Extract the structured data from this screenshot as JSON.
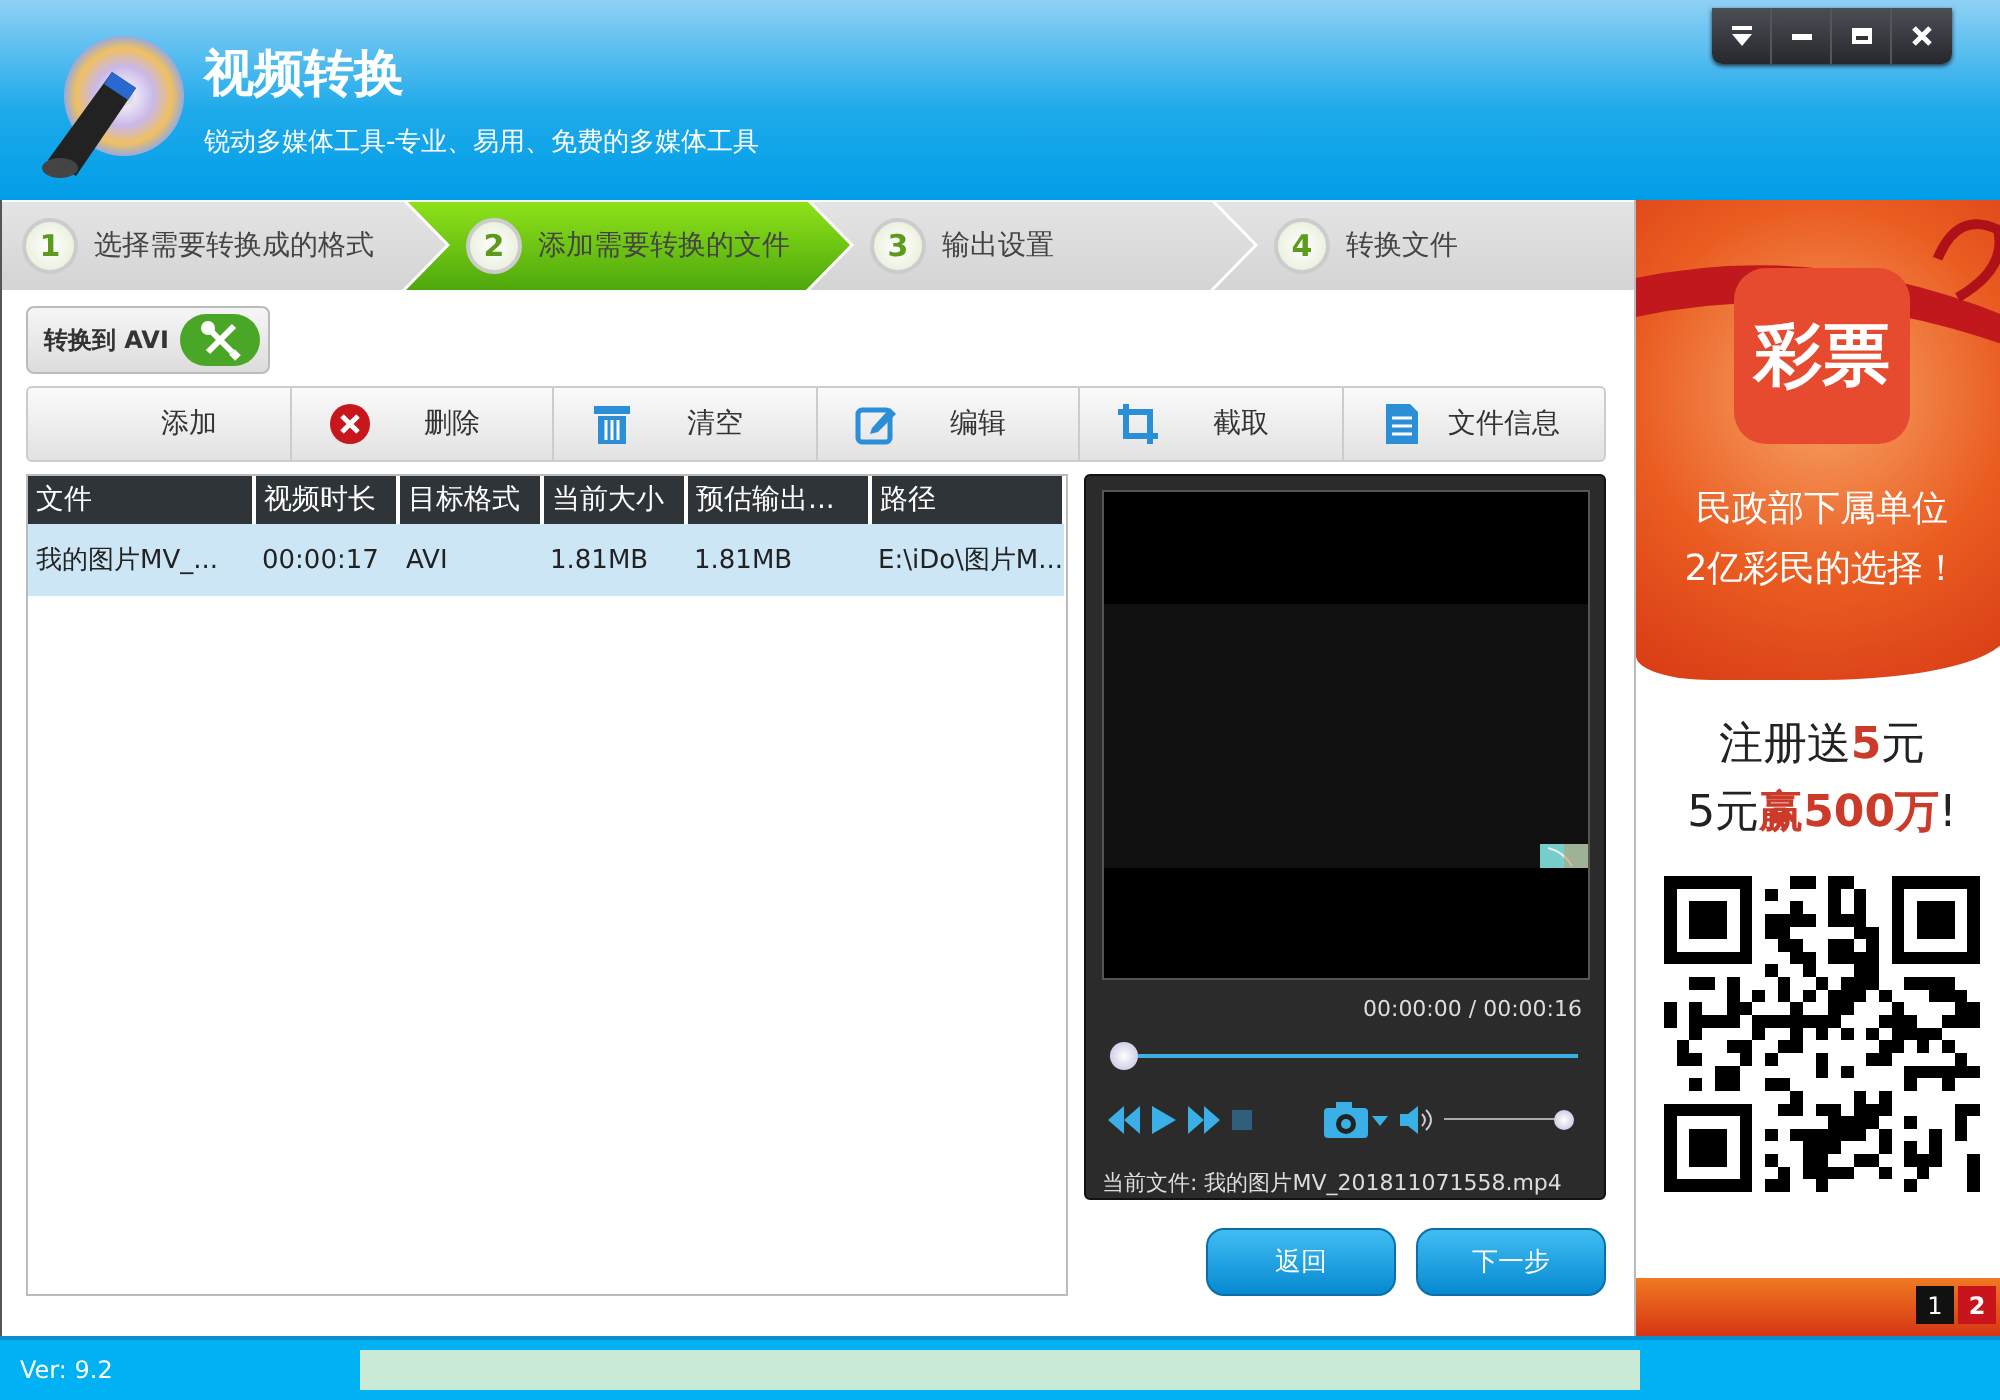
{
  "window": {
    "title": "视频转换",
    "subtitle": "锐动多媒体工具-专业、易用、免费的多媒体工具"
  },
  "steps": [
    {
      "number": "1",
      "label": "选择需要转换成的格式",
      "selected": false
    },
    {
      "number": "2",
      "label": "添加需要转换的文件",
      "selected": true
    },
    {
      "number": "3",
      "label": "输出设置",
      "selected": false
    },
    {
      "number": "4",
      "label": "转换文件",
      "selected": false
    }
  ],
  "format_button": {
    "label": "转换到 AVI"
  },
  "toolbar": [
    "添加",
    "删除",
    "清空",
    "编辑",
    "截取",
    "文件信息"
  ],
  "table": {
    "columns": [
      "文件",
      "视频时长",
      "目标格式",
      "当前大小",
      "预估输出...",
      "路径"
    ],
    "rows": [
      {
        "selected": true,
        "cells": [
          "我的图片MV_...",
          "00:00:17",
          "AVI",
          "1.81MB",
          "1.81MB",
          "E:\\iDo\\图片M..."
        ]
      }
    ]
  },
  "player": {
    "time": "00:00:00 / 00:00:16",
    "seek": {
      "level": 0
    },
    "volume": {
      "level": 1
    },
    "current_file": "当前文件: 我的图片MV_201811071558.mp4"
  },
  "buttons": [
    "返回",
    "下一步"
  ],
  "ad": {
    "logo": "彩票",
    "lines": [
      "民政部下属单位",
      "2亿彩民的选择！"
    ],
    "offer": [
      [
        {
          "text": "注册送",
          "highlight": false
        },
        {
          "text": "5",
          "highlight": true
        },
        {
          "text": "元",
          "highlight": false
        }
      ],
      [
        {
          "text": "5元",
          "highlight": false
        },
        {
          "text": "赢500万",
          "highlight": true
        },
        {
          "text": "!",
          "highlight": false
        }
      ]
    ],
    "pages": [
      {
        "label": "1",
        "selected": false
      },
      {
        "label": "2",
        "selected": true
      }
    ]
  },
  "status_bar": {
    "version": "Ver: 9.2",
    "progress": {
      "level": 0
    }
  }
}
